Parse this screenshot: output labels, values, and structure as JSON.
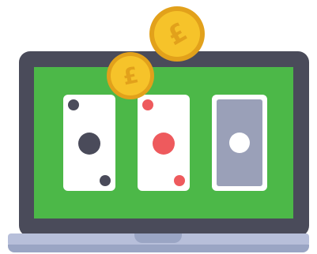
{
  "illustration": {
    "coins": [
      {
        "symbol": "£"
      },
      {
        "symbol": "£"
      }
    ],
    "cards": [
      {
        "face": "up",
        "pip_color": "dark"
      },
      {
        "face": "up",
        "pip_color": "red"
      },
      {
        "face": "down"
      }
    ],
    "colors": {
      "screen_green": "#4cb848",
      "frame_dark": "#4a4b5a",
      "card_red": "#ee5a5d",
      "card_back": "#9aa0b8",
      "coin_gold": "#f6c32a",
      "base": "#b7bfda"
    }
  }
}
